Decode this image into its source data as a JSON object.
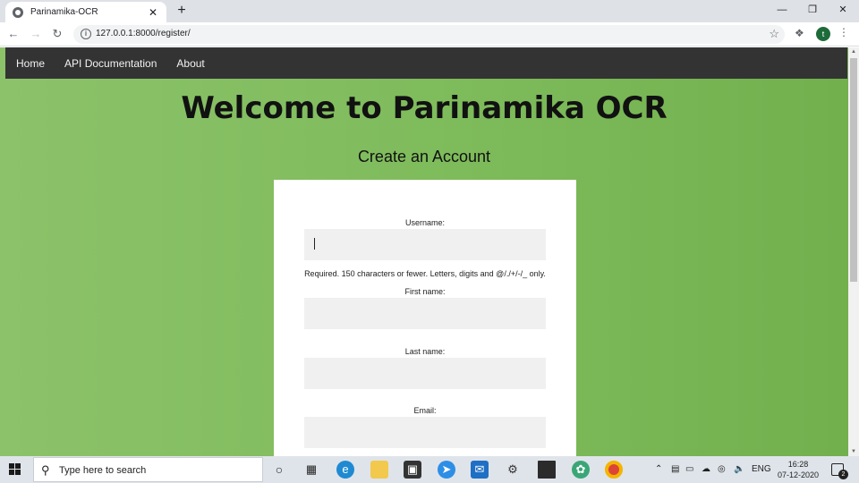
{
  "browser": {
    "tab_title": "Parinamika-OCR",
    "tab_close": "✕",
    "new_tab": "+",
    "url": "127.0.0.1:8000/register/",
    "minimize": "—",
    "restore": "❐",
    "close": "✕",
    "profile_initial": "t"
  },
  "nav": {
    "items": [
      "Home",
      "API Documentation",
      "About"
    ]
  },
  "page": {
    "headline": "Welcome to Parinamika OCR",
    "subheading": "Create an Account",
    "form": {
      "username_label": "Username:",
      "username_value": "",
      "username_help": "Required. 150 characters or fewer. Letters, digits and @/./+/-/_ only.",
      "first_name_label": "First name:",
      "last_name_label": "Last name:",
      "email_label": "Email:"
    }
  },
  "taskbar": {
    "search_placeholder": "Type here to search",
    "language": "ENG",
    "time": "16:28",
    "date": "07-12-2020",
    "notification_count": "2"
  },
  "colors": {
    "page_bg": "#7fbc5c",
    "navbar_bg": "#333333",
    "field_bg": "#f0f0f0"
  }
}
